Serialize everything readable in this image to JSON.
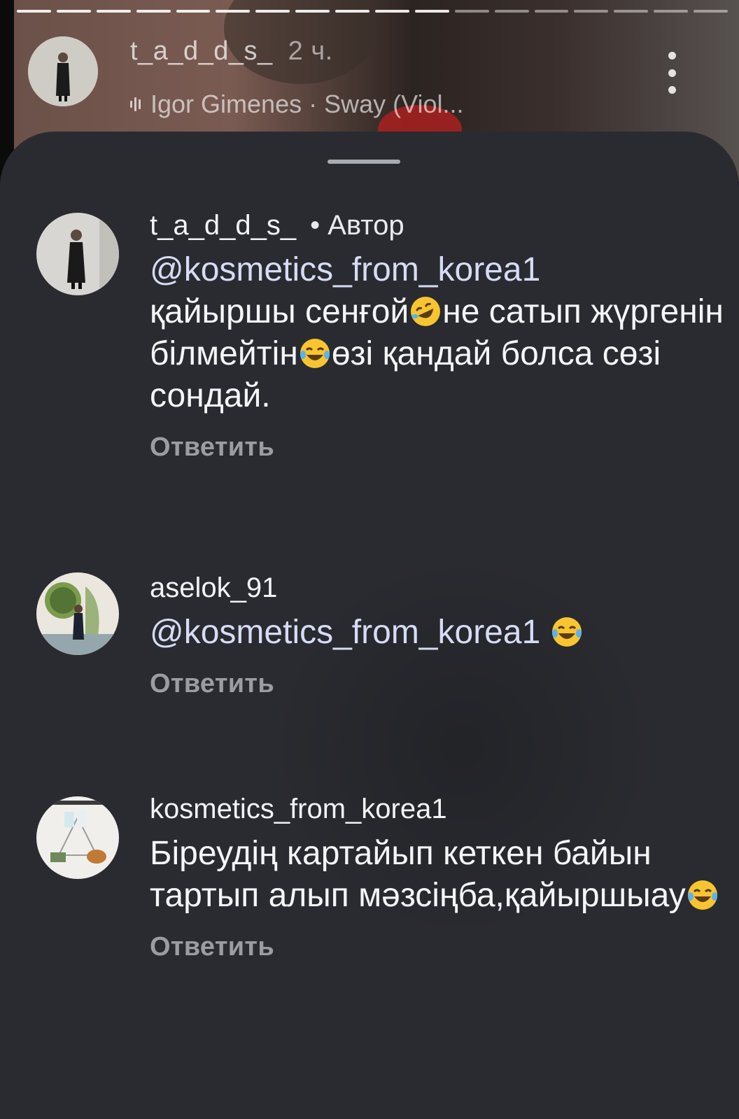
{
  "story": {
    "username": "t_a_d_d_s_",
    "time": "2 ч.",
    "music": "Igor Gimenes · Sway (Viol..."
  },
  "comments": [
    {
      "username": "t_a_d_d_s_",
      "author_badge": "• Автор",
      "mention": "@kosmetics_from_korea1",
      "text_parts": [
        "қайыршы сенғой",
        "не сатып жүргенін білмейтін",
        "өзі қандай болса сөзі сондай."
      ],
      "emojis": [
        "rolling-on-floor-laughing-emoji",
        "tears-of-joy-emoji"
      ],
      "reply": "Ответить"
    },
    {
      "username": "aselok_91",
      "mention": "@kosmetics_from_korea1",
      "emojis": [
        "tears-of-joy-emoji"
      ],
      "reply": "Ответить"
    },
    {
      "username": "kosmetics_from_korea1",
      "text_parts": [
        "Біреудің картайып кеткен байын тартып алып мәзсіңба,қайыршыау"
      ],
      "emojis": [
        "tears-of-joy-emoji"
      ],
      "reply": "Ответить"
    }
  ],
  "colors": {
    "sheet": "#2a2b30",
    "text": "#f4f5f7",
    "mention": "#d6dcf5",
    "muted": "#9a9da4"
  }
}
